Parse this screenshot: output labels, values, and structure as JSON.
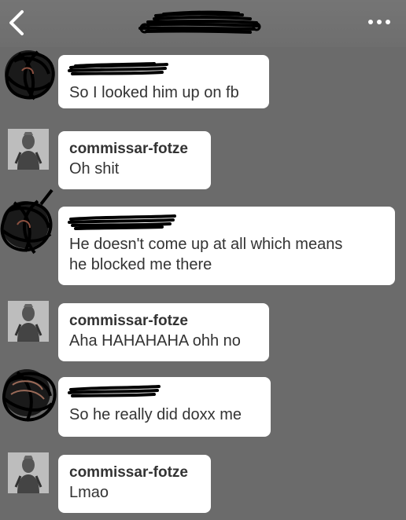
{
  "header": {
    "back_icon": "chevron-left-icon",
    "title": "",
    "menu_icon": "more-horizontal-icon"
  },
  "messages": [
    {
      "sender": "",
      "text": "So I looked him up on fb",
      "redacted": true
    },
    {
      "sender": "commissar-fotze",
      "text": "Oh shit",
      "redacted": false
    },
    {
      "sender": "",
      "text": "He doesn't come up at all which means",
      "text2": "he blocked me there",
      "redacted": true
    },
    {
      "sender": "commissar-fotze",
      "text": "Aha HAHAHAHA ohh no",
      "redacted": false
    },
    {
      "sender": "",
      "text": "So he really did doxx me",
      "redacted": true
    },
    {
      "sender": "commissar-fotze",
      "text": "Lmao",
      "redacted": false
    }
  ],
  "colors": {
    "background": "#6b6b6b",
    "bubble": "#ffffff",
    "text": "#333333",
    "redaction": "#000000"
  }
}
